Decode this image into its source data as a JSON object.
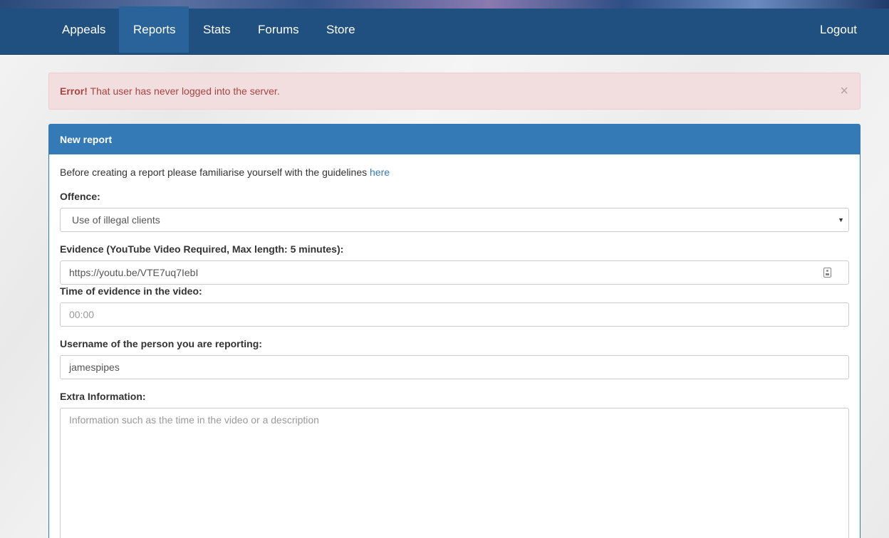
{
  "nav": {
    "items": [
      "Appeals",
      "Reports",
      "Stats",
      "Forums",
      "Store"
    ],
    "active": "Reports",
    "logout": "Logout"
  },
  "alert": {
    "strong": "Error!",
    "message": "That user has never logged into the server.",
    "close": "×"
  },
  "panel": {
    "title": "New report",
    "intro": "Before creating a report please familiarise yourself with the guidelines",
    "intro_link": "here"
  },
  "form": {
    "offence_label": "Offence:",
    "offence_value": "Use of illegal clients",
    "evidence_label": "Evidence (YouTube Video Required, Max length: 5 minutes):",
    "evidence_value": "https://youtu.be/VTE7uq7IebI",
    "time_label": "Time of evidence in the video:",
    "time_placeholder": "00:00",
    "username_label": "Username of the person you are reporting:",
    "username_value": "jamespipes",
    "extra_label": "Extra Information:",
    "extra_placeholder": "Information such as the time in the video or a description"
  },
  "colors": {
    "navbar": "#1f5080",
    "panel": "#337ab7",
    "alert_bg": "#f2dede",
    "alert_text": "#a94442"
  }
}
